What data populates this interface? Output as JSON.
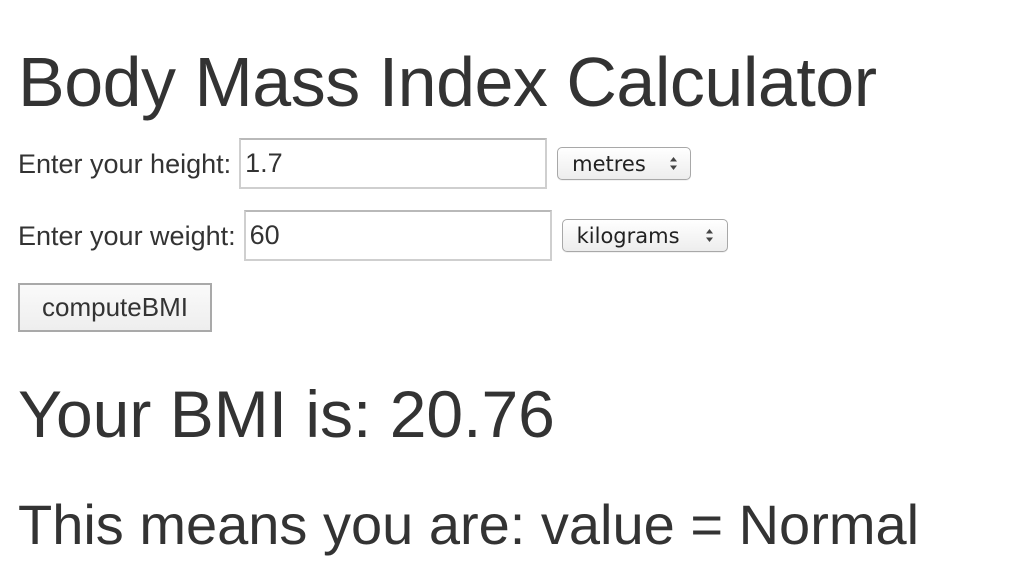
{
  "page": {
    "title": "Body Mass Index Calculator"
  },
  "height": {
    "label": "Enter your height:",
    "value": "1.7",
    "unit": "metres"
  },
  "weight": {
    "label": "Enter your weight:",
    "value": "60",
    "unit": "kilograms"
  },
  "compute": {
    "label": "computeBMI"
  },
  "result": {
    "label": "Your BMI is: ",
    "value": "20.76"
  },
  "category": {
    "label": "This means you are: ",
    "value": "value = Normal"
  },
  "icons": {
    "select_indicator": "updown-chevron-icon"
  },
  "colors": {
    "text": "#333333",
    "input_border": "#cfcfcf",
    "button_border": "#a9a9a9",
    "background": "#ffffff"
  }
}
